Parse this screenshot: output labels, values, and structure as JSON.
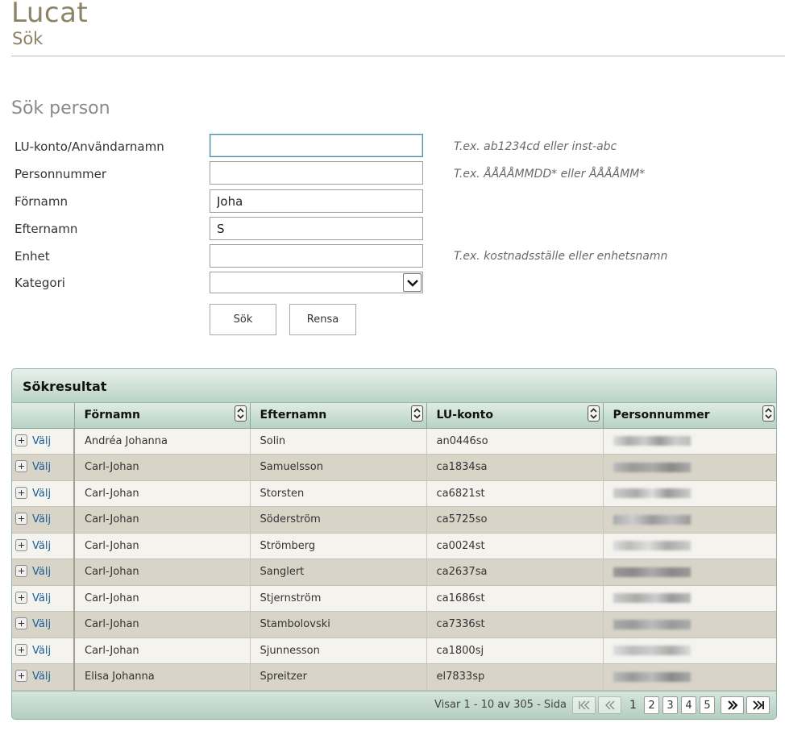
{
  "header": {
    "app_title": "Lucat",
    "page_title": "Sök"
  },
  "search_form": {
    "section_title": "Sök person",
    "fields": {
      "lu_account": {
        "label": "LU-konto/Användarnamn",
        "value": "",
        "hint": "T.ex. ab1234cd eller inst-abc"
      },
      "personal_number": {
        "label": "Personnummer",
        "value": "",
        "hint": "T.ex. ÅÅÅÅMMDD* eller ÅÅÅÅMM*"
      },
      "first_name": {
        "label": "Förnamn",
        "value": "Joha"
      },
      "last_name": {
        "label": "Efternamn",
        "value": "S"
      },
      "unit": {
        "label": "Enhet",
        "value": "",
        "hint": "T.ex. kostnadsställe eller enhetsnamn"
      },
      "category": {
        "label": "Kategori",
        "value": ""
      }
    },
    "buttons": {
      "search": "Sök",
      "clear": "Rensa"
    }
  },
  "results": {
    "title": "Sökresultat",
    "columns": [
      "Förnamn",
      "Efternamn",
      "LU-konto",
      "Personnummer"
    ],
    "select_label": "Välj",
    "rows": [
      {
        "first_name": "Andréa Johanna",
        "last_name": "Solin",
        "lu_account": "an0446so"
      },
      {
        "first_name": "Carl-Johan",
        "last_name": "Samuelsson",
        "lu_account": "ca1834sa"
      },
      {
        "first_name": "Carl-Johan",
        "last_name": "Storsten",
        "lu_account": "ca6821st"
      },
      {
        "first_name": "Carl-Johan",
        "last_name": "Söderström",
        "lu_account": "ca5725so"
      },
      {
        "first_name": "Carl-Johan",
        "last_name": "Strömberg",
        "lu_account": "ca0024st"
      },
      {
        "first_name": "Carl-Johan",
        "last_name": "Sanglert",
        "lu_account": "ca2637sa"
      },
      {
        "first_name": "Carl-Johan",
        "last_name": "Stjernström",
        "lu_account": "ca1686st"
      },
      {
        "first_name": "Carl-Johan",
        "last_name": "Stambolovski",
        "lu_account": "ca7336st"
      },
      {
        "first_name": "Carl-Johan",
        "last_name": "Sjunnesson",
        "lu_account": "ca1800sj"
      },
      {
        "first_name": "Elisa Johanna",
        "last_name": "Spreitzer",
        "lu_account": "el7833sp"
      }
    ],
    "paging": {
      "info": "Visar 1 - 10 av 305 - Sida",
      "current_page": "1",
      "pages": [
        "2",
        "3",
        "4",
        "5"
      ],
      "first": "⏮",
      "prev": "«",
      "next": "»",
      "last": "⏭"
    }
  },
  "colors": {
    "brand": "#8c8466",
    "link": "#1a5e9a",
    "panel_green": "#b9d3c6"
  }
}
